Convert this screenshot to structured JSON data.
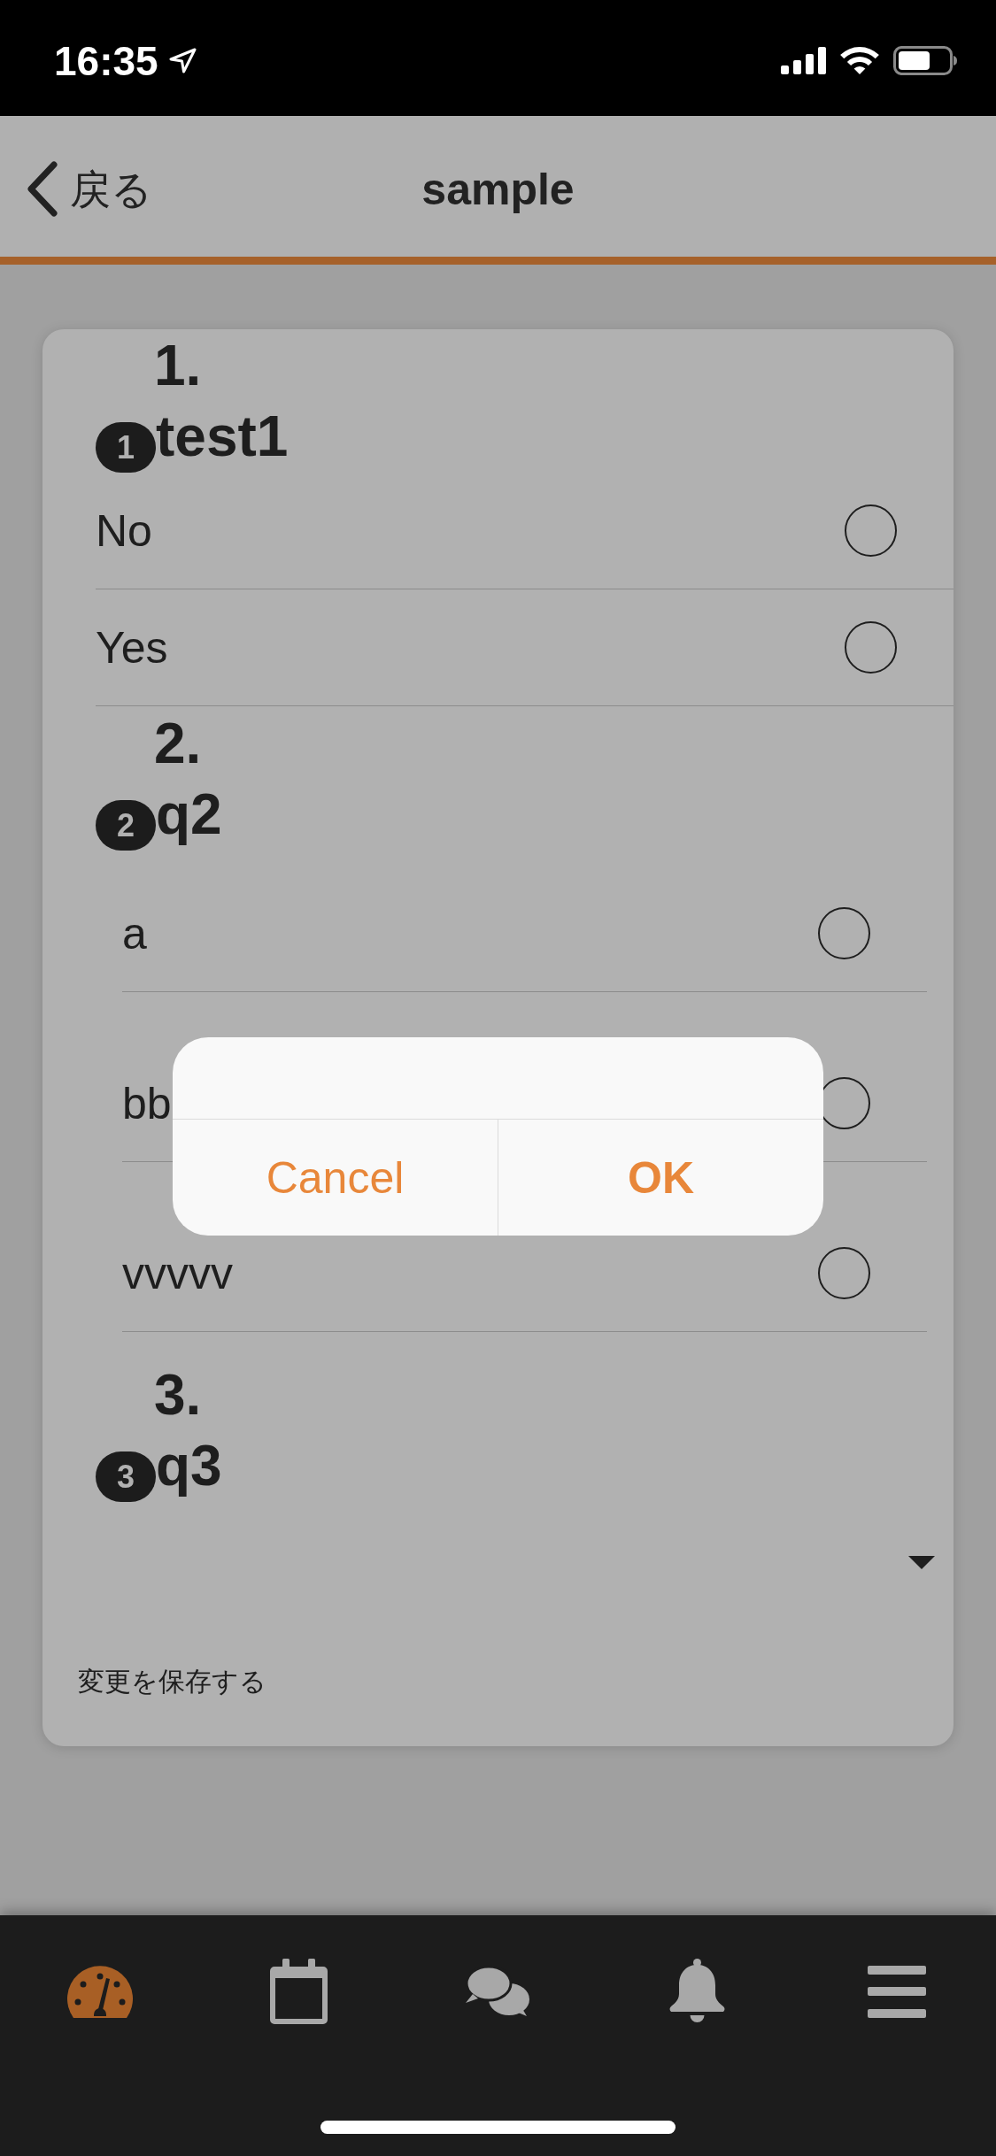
{
  "status_bar": {
    "time": "16:35"
  },
  "nav_bar": {
    "back": "戻る",
    "title": "sample"
  },
  "form": {
    "questions": [
      {
        "kind": "yes_no",
        "number": "1.",
        "badge": "1",
        "title": "test1",
        "options": [
          {
            "label": "No",
            "selected": false
          },
          {
            "label": "Yes",
            "selected": false
          }
        ]
      },
      {
        "kind": "choice",
        "number": "2.",
        "badge": "2",
        "title": "q2",
        "options": [
          {
            "label": "a",
            "selected": false
          },
          {
            "label": "bb",
            "selected": false
          },
          {
            "label": "vvvvv",
            "selected": false
          }
        ]
      },
      {
        "kind": "dropdown",
        "number": "3.",
        "badge": "3",
        "title": "q3"
      }
    ],
    "save": "変更を保存する"
  },
  "dialog": {
    "buttons": [
      {
        "kind": "cancel",
        "label": "Cancel"
      },
      {
        "kind": "default",
        "label": "OK"
      }
    ]
  },
  "tab_bar": {
    "tabs": [
      {
        "selected": true
      },
      {
        "selected": false
      },
      {
        "selected": false
      },
      {
        "selected": false
      },
      {
        "selected": false
      }
    ]
  }
}
